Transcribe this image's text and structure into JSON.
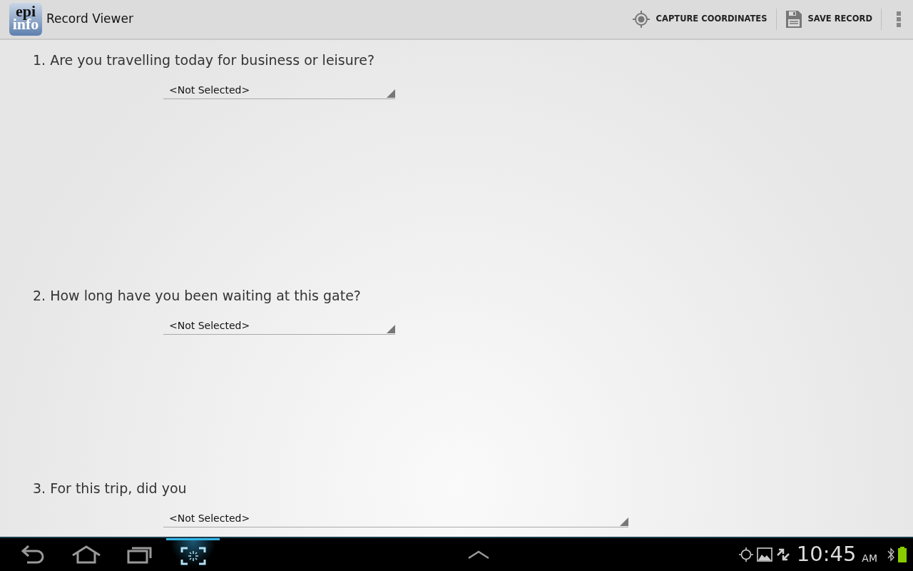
{
  "action_bar": {
    "logo": {
      "top": "epi",
      "bottom": "info"
    },
    "title": "Record Viewer",
    "actions": [
      {
        "kind": "target",
        "label": "CAPTURE COORDINATES"
      },
      {
        "kind": "save",
        "label": "SAVE RECORD"
      }
    ]
  },
  "questions": [
    {
      "label": "1. Are you travelling today for business or leisure?",
      "value": "<Not Selected>"
    },
    {
      "label": "2. How long have you been waiting at this gate?",
      "value": "<Not Selected>"
    },
    {
      "label": "3. For this trip, did you",
      "value": "<Not Selected>"
    }
  ],
  "nav_bar": {
    "buttons": [
      {
        "kind": "back",
        "selected": false
      },
      {
        "kind": "home",
        "selected": false
      },
      {
        "kind": "recent",
        "selected": false
      },
      {
        "kind": "screenshot",
        "selected": true
      }
    ],
    "time": "10:45",
    "ampm": "AM"
  }
}
